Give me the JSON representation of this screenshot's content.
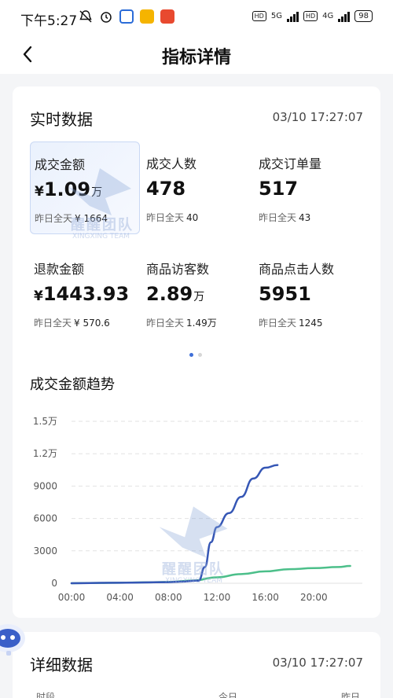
{
  "status_bar": {
    "time": "下午5:27",
    "network_1": "5G",
    "network_2": "4G",
    "hd": "HD",
    "battery": "98"
  },
  "nav": {
    "title": "指标详情"
  },
  "realtime": {
    "title": "实时数据",
    "timestamp": "03/10 17:27:07",
    "yesterday_label": "昨日全天",
    "metrics": [
      {
        "label": "成交金额",
        "prefix": "¥",
        "value": "1.09",
        "unit": "万",
        "yesterday": "¥ 1664",
        "active": true
      },
      {
        "label": "成交人数",
        "prefix": "",
        "value": "478",
        "unit": "",
        "yesterday": "40"
      },
      {
        "label": "成交订单量",
        "prefix": "",
        "value": "517",
        "unit": "",
        "yesterday": "43"
      },
      {
        "label": "退款金额",
        "prefix": "¥",
        "value": "1443.93",
        "unit": "",
        "yesterday": "¥ 570.6"
      },
      {
        "label": "商品访客数",
        "prefix": "",
        "value": "2.89",
        "unit": "万",
        "yesterday": "1.49万"
      },
      {
        "label": "商品点击人数",
        "prefix": "",
        "value": "5951",
        "unit": "",
        "yesterday": "1245"
      }
    ],
    "pager": {
      "pages": 2,
      "current": 1
    }
  },
  "trend": {
    "title": "成交金额趋势"
  },
  "watermark": {
    "text": "醒醒团队",
    "subtext": "XINGXING TEAM"
  },
  "detail": {
    "title": "详细数据",
    "timestamp": "03/10 17:27:07",
    "columns": [
      "时段",
      "今日",
      "昨日"
    ]
  },
  "colors": {
    "today": "#3556b5",
    "yesterday": "#4cbf8a",
    "accent": "#3f6fd8"
  },
  "chart_data": {
    "type": "line",
    "title": "成交金额趋势",
    "x_tick_labels": [
      "00:00",
      "04:00",
      "08:00",
      "12:00",
      "16:00",
      "20:00"
    ],
    "y_tick_labels": [
      "0",
      "3000",
      "6000",
      "9000",
      "1.2万",
      "1.5万"
    ],
    "y_ticks": [
      0,
      3000,
      6000,
      9000,
      12000,
      15000
    ],
    "xlim": [
      0,
      24
    ],
    "ylim": [
      0,
      15000
    ],
    "grid": true,
    "series": [
      {
        "color": "#3556b5",
        "x": [
          0,
          4,
          8,
          9,
          10.5,
          11,
          11.5,
          12,
          13,
          14,
          15,
          16,
          17
        ],
        "y": [
          0,
          50,
          100,
          150,
          250,
          1500,
          3800,
          5200,
          6500,
          8000,
          9700,
          10700,
          10950
        ]
      },
      {
        "color": "#4cbf8a",
        "x": [
          0,
          2,
          4,
          6,
          8,
          10,
          12,
          14,
          16,
          18,
          20,
          22,
          23
        ],
        "y": [
          0,
          30,
          50,
          80,
          120,
          250,
          550,
          850,
          1100,
          1300,
          1400,
          1500,
          1600
        ]
      }
    ]
  }
}
